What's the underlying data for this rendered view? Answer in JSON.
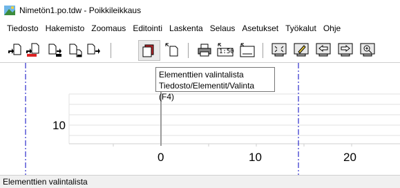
{
  "window": {
    "title": "Nimetön1.po.tdw - Poikkileikkaus"
  },
  "menu": {
    "items": [
      "Tiedosto",
      "Hakemisto",
      "Zoomaus",
      "Editointi",
      "Laskenta",
      "Selaus",
      "Asetukset",
      "Työkalut",
      "Ohje"
    ]
  },
  "toolbar": {
    "scale_label": "1:50"
  },
  "tooltip": {
    "line1": "Elementtien valintalista",
    "line2": "Tiedosto/Elementit/Valinta (F4)"
  },
  "canvas": {
    "y_tick_label": "10",
    "x_tick_labels": [
      "0",
      "10",
      "20"
    ]
  },
  "statusbar": {
    "text": "Elementtien valintalista"
  },
  "colors": {
    "guide_line": "#2b2bcc",
    "grid": "#d8d8d8",
    "axis": "#808080"
  }
}
